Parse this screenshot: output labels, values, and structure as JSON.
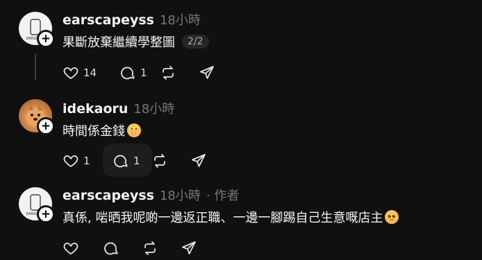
{
  "posts": [
    {
      "username": "earscapeyss",
      "time": "18小時",
      "text": "果斷放棄繼續學整圖",
      "page_indicator": "2/2",
      "likes": "14",
      "replies": "1",
      "avatar_text": "EARSCAPE",
      "avatar": "earscape-logo",
      "following_badge": "+"
    },
    {
      "username": "idekaoru",
      "time": "18小時",
      "text": "時間係金錢",
      "likes": "1",
      "replies": "1",
      "avatar": "pomeranian-dog",
      "following_badge": "+"
    },
    {
      "username": "earscapeyss",
      "time": "18小時",
      "author_tag": "· 作者",
      "text": "真係, 啱晒我呢啲一邊返正職、一邊一腳踢自己生意嘅店主",
      "avatar_text": "EARSCAPE",
      "avatar": "earscape-logo",
      "following_badge": "+"
    }
  ],
  "icons": {
    "like": "heart-icon",
    "reply": "comment-icon",
    "repost": "repost-icon",
    "share": "send-icon"
  },
  "colors": {
    "background": "#101010",
    "text": "#f3f5f7",
    "muted": "#777777"
  }
}
